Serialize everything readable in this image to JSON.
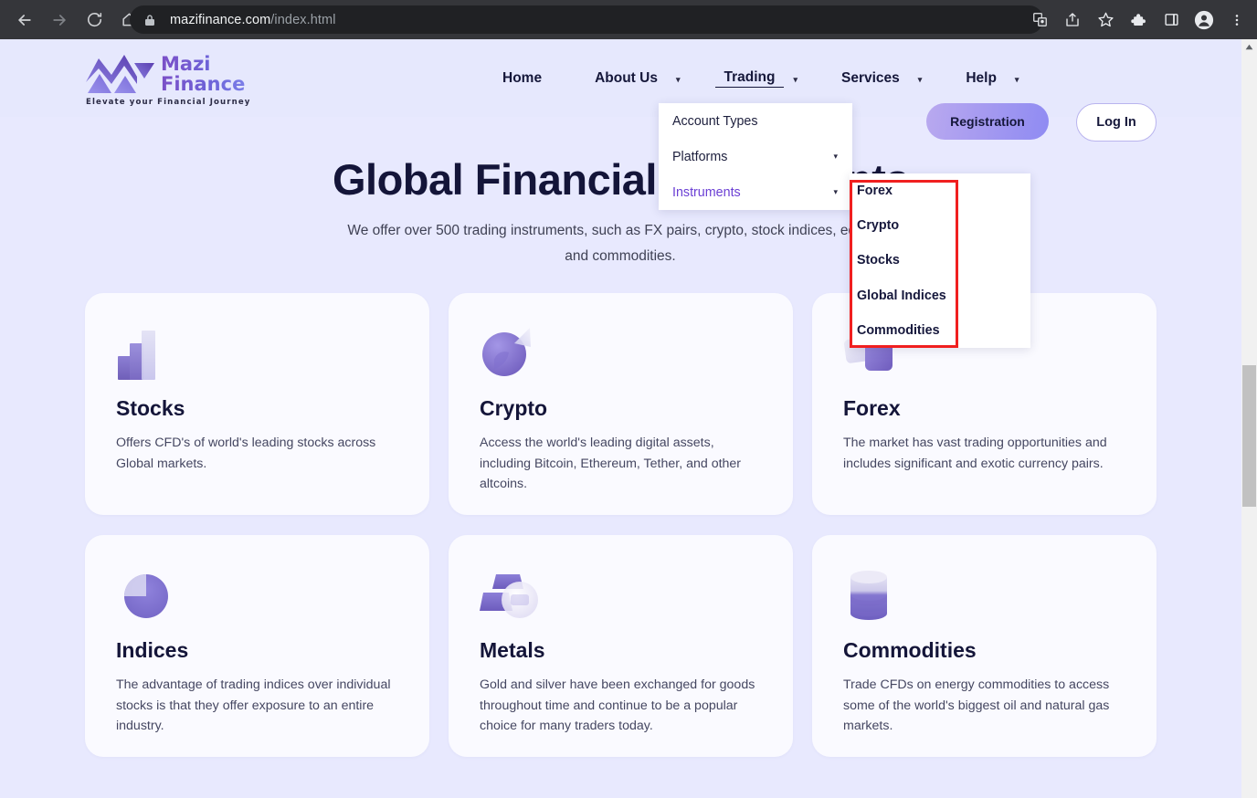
{
  "browser": {
    "url_domain": "mazifinance.com",
    "url_path": "/index.html",
    "back_icon": "back-arrow-icon",
    "forward_icon": "forward-arrow-icon",
    "reload_icon": "reload-icon",
    "home_icon": "home-icon",
    "lock_icon": "lock-icon",
    "toolbar_icons": [
      "translate-icon",
      "share-icon",
      "bookmark-star-icon",
      "extensions-puzzle-icon",
      "side-panel-icon",
      "profile-avatar-icon",
      "three-dot-menu-icon"
    ]
  },
  "site": {
    "logo": {
      "mark": "mazi-m-logo-icon",
      "line1": "Mazi",
      "line2": "Finance",
      "tagline": "Elevate your Financial Journey"
    },
    "nav": [
      {
        "label": "Home",
        "has_caret": false,
        "active": false
      },
      {
        "label": "About Us",
        "has_caret": true,
        "active": false
      },
      {
        "label": "Trading",
        "has_caret": true,
        "active": true
      },
      {
        "label": "Services",
        "has_caret": true,
        "active": false
      },
      {
        "label": "Help",
        "has_caret": true,
        "active": false
      }
    ],
    "registration_label": "Registration",
    "login_label": "Log In",
    "colors": {
      "header_bg": "#e6e8fd",
      "body_bg": "#e8e9fe",
      "card_bg": "#fafaff",
      "accent_purple": "#6b3fd4",
      "heading": "#141539",
      "annotation_red": "#f01f1f"
    }
  },
  "hero": {
    "title": "Global Financial Instruments",
    "subtitle": "We offer over 500 trading instruments, such as FX pairs, crypto, stock indices, equities, and commodities."
  },
  "dropdown_trading": {
    "items": [
      {
        "label": "Account Types",
        "caret": "",
        "highlight": false
      },
      {
        "label": "Platforms",
        "caret": "▾",
        "highlight": false
      },
      {
        "label": "Instruments",
        "caret": "▾",
        "highlight": true
      }
    ]
  },
  "dropdown_instruments": {
    "items": [
      {
        "label": "Forex"
      },
      {
        "label": "Crypto"
      },
      {
        "label": "Stocks"
      },
      {
        "label": "Global Indices"
      },
      {
        "label": "Commodities"
      }
    ]
  },
  "cards": [
    {
      "icon": "bar-chart-icon",
      "title": "Stocks",
      "desc": "Offers CFD's of world's leading stocks across Global markets."
    },
    {
      "icon": "crypto-sphere-icon",
      "title": "Crypto",
      "desc": "Access the world's leading digital assets, including Bitcoin, Ethereum, Tether, and other altcoins."
    },
    {
      "icon": "currency-cards-icon",
      "title": "Forex",
      "desc": "The market has vast trading opportunities and includes significant and exotic currency pairs."
    },
    {
      "icon": "pie-chart-icon",
      "title": "Indices",
      "desc": "The advantage of trading indices over individual stocks is that they offer exposure to an entire industry."
    },
    {
      "icon": "gold-bars-icon",
      "title": "Metals",
      "desc": "Gold and silver have been exchanged for goods throughout time and continue to be a popular choice for many traders today."
    },
    {
      "icon": "oil-barrel-icon",
      "title": "Commodities",
      "desc": "Trade CFDs on energy commodities to access some of the world's biggest oil and natural gas markets."
    }
  ],
  "scrollbar": {
    "up_arrow_icon": "scroll-up-arrow-icon"
  }
}
